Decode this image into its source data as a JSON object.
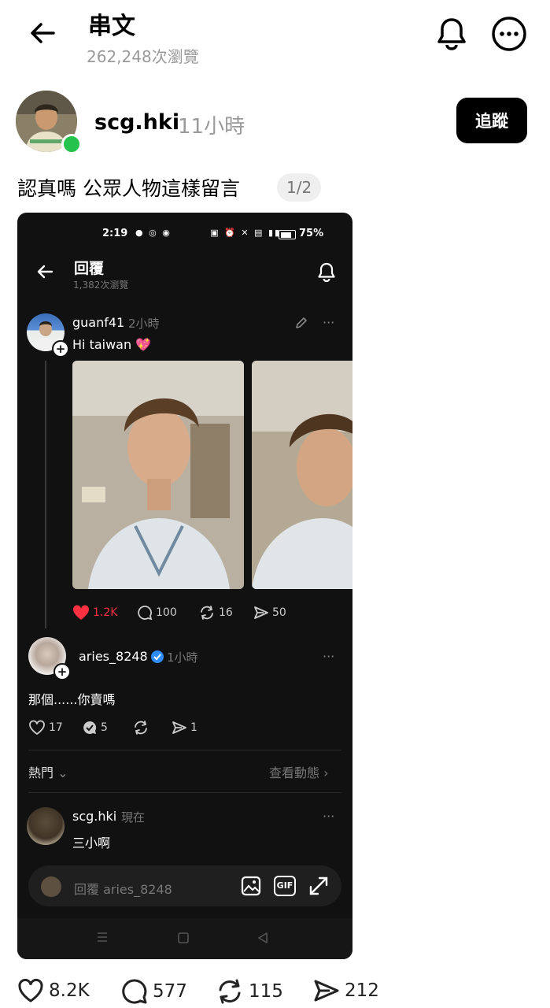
{
  "header": {
    "title": "串文",
    "views": "262,248次瀏覽"
  },
  "author": {
    "username": "scg.hki",
    "time": "11小時",
    "follow_label": "追蹤"
  },
  "post": {
    "caption": "認真嗎 公眾人物這樣留言",
    "pager": "1/2",
    "stats": {
      "likes": "8.2K",
      "comments": "577",
      "reposts": "115",
      "shares": "212"
    }
  },
  "embedded": {
    "status_bar": {
      "time": "2:19",
      "battery": "75%"
    },
    "header": {
      "title": "回覆",
      "views": "1,382次瀏覽"
    },
    "root_post": {
      "username": "guanf41",
      "time": "2小時",
      "text": "Hi taiwan 💖",
      "stats": {
        "likes": "1.2K",
        "comments": "100",
        "reposts": "16",
        "shares": "50"
      }
    },
    "reply1": {
      "username": "aries_8248",
      "time": "1小時",
      "text": "那個......你賣嗎",
      "stats": {
        "likes": "17",
        "comments": "5",
        "reposts": "",
        "shares": "1"
      }
    },
    "sort_label": "熱門",
    "view_activity_label": "查看動態",
    "reply2": {
      "username": "scg.hki",
      "time": "現在",
      "text": "三小啊"
    },
    "composer": {
      "placeholder": "回覆 aries_8248",
      "gif_label": "GIF"
    },
    "colors": {
      "like_red": "#ff3040",
      "verified_blue": "#2f8cff"
    }
  },
  "colors": {
    "online_green": "#26c24e"
  }
}
